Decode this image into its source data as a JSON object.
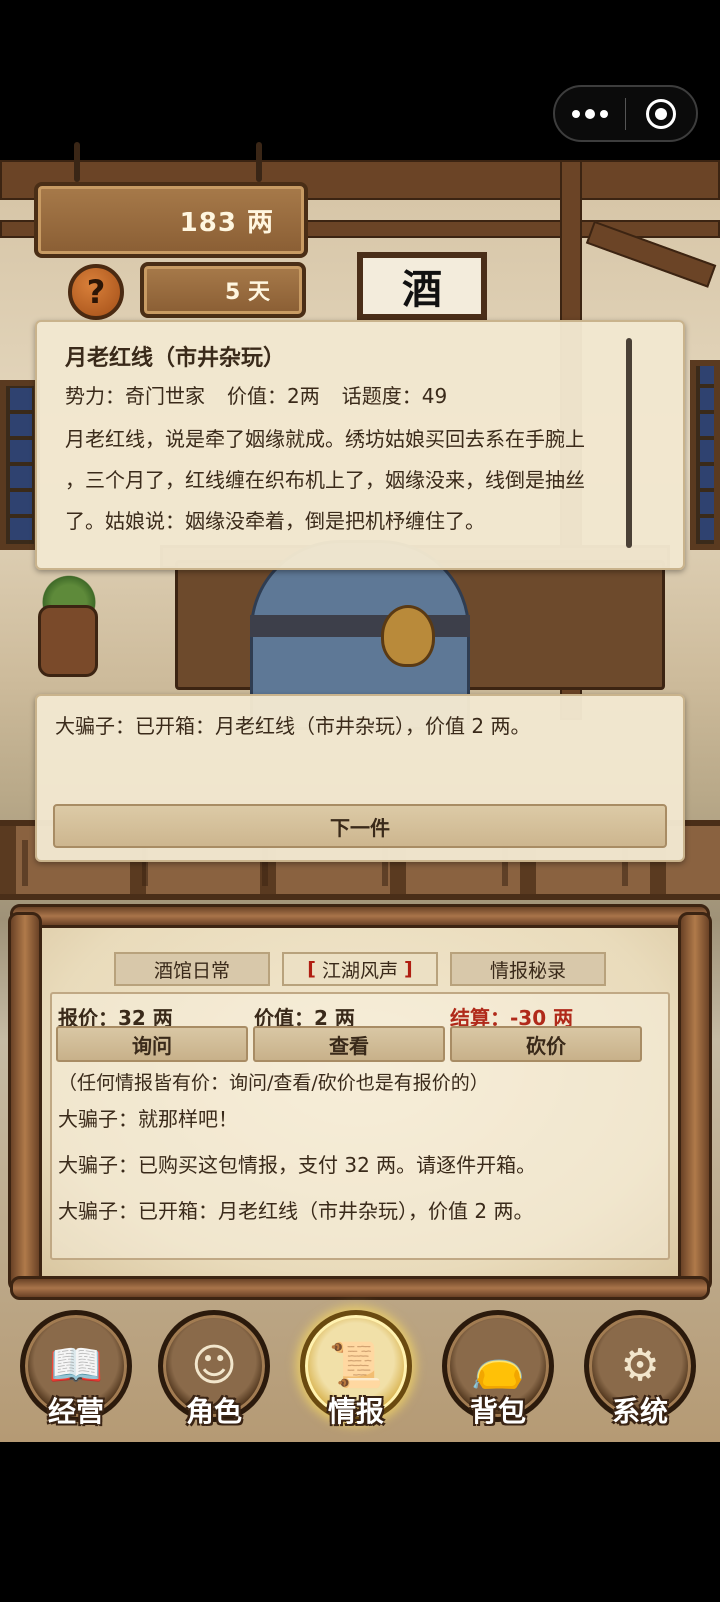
{
  "hud": {
    "money": "183 两",
    "days": "5 天",
    "help_icon": "?",
    "sign_text": "酒"
  },
  "item": {
    "title": "月老红线（市井杂玩）",
    "faction": "势力：奇门世家",
    "value": "价值：2两",
    "topic": "话题度：49",
    "desc_lines": [
      "月老红线，说是牵了姻缘就成。绣坊姑娘买回去系在手腕上",
      "，三个月了，红线缠在织布机上了，姻缘没来，线倒是抽丝",
      "了。姑娘说：姻缘没牵着，倒是把机杼缠住了。"
    ]
  },
  "dialog": {
    "line": "大骗子：已开箱：月老红线（市井杂玩），价值 2 两。",
    "next_label": "下一件"
  },
  "intel": {
    "tabs": [
      {
        "label": "酒馆日常",
        "active": false
      },
      {
        "label": "江湖风声",
        "active": true
      },
      {
        "label": "情报秘录",
        "active": false
      }
    ],
    "tab_brackets": [
      "[",
      "]"
    ],
    "stats": {
      "quote": "报价：32 两",
      "value": "价值：2 两",
      "settle": "结算：-30 两"
    },
    "actions": {
      "ask": "询问",
      "check": "查看",
      "bargain": "砍价"
    },
    "note": "（任何情报皆有价：询问/查看/砍价也是有报价的）",
    "log": [
      "大骗子：就那样吧！",
      "大骗子：已购买这包情报，支付 32 两。请逐件开箱。",
      "大骗子：已开箱：月老红线（市井杂玩），价值 2 两。"
    ]
  },
  "nav": {
    "items": [
      {
        "label": "经营",
        "icon": "ledger-abacus-icon",
        "active": false
      },
      {
        "label": "角色",
        "icon": "character-portrait-icon",
        "active": false
      },
      {
        "label": "情报",
        "icon": "scroll-icon",
        "active": true
      },
      {
        "label": "背包",
        "icon": "bag-icon",
        "active": false
      },
      {
        "label": "系统",
        "icon": "gear-icon",
        "active": false
      }
    ]
  },
  "colors": {
    "accent_red": "#b02a1a",
    "parchment": "#f3e8cf",
    "wood": "#8a5e34"
  }
}
